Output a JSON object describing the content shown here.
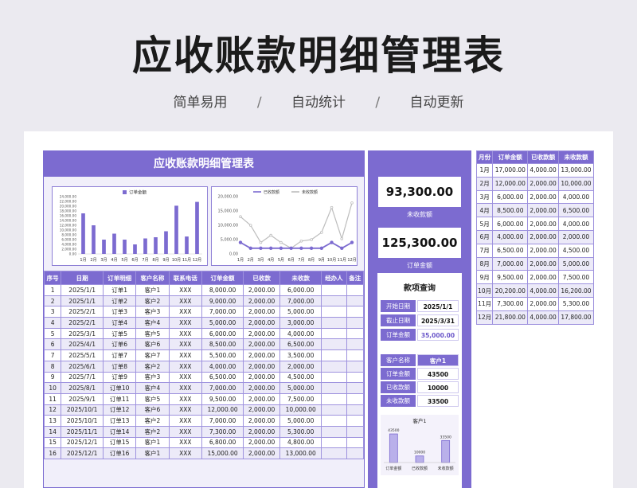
{
  "header": {
    "title": "应收账款明细管理表",
    "tags": [
      "简单易用",
      "自动统计",
      "自动更新"
    ],
    "separator": "/"
  },
  "panel": {
    "title": "应收账款明细管理表"
  },
  "colors": {
    "accent": "#7c6bd0",
    "light": "#eceaf8",
    "line_received": "#7c6bd0",
    "line_outstanding": "#bdbdbd"
  },
  "chart_data": [
    {
      "type": "bar",
      "title": "",
      "legend": [
        "订单金额"
      ],
      "categories": [
        "1月",
        "2月",
        "3月",
        "4月",
        "5月",
        "6月",
        "7月",
        "8月",
        "9月",
        "10月",
        "11月",
        "12月"
      ],
      "series": [
        {
          "name": "订单金额",
          "values": [
            17000,
            12000,
            6000,
            8500,
            6000,
            4000,
            6500,
            7000,
            9500,
            20200,
            7300,
            21800
          ]
        }
      ],
      "ylim": [
        0,
        24000
      ],
      "yticks": [
        "24,000.00",
        "22,000.00",
        "20,000.00",
        "18,000.00",
        "16,000.00",
        "14,000.00",
        "12,000.00",
        "10,000.00",
        "8,000.00",
        "6,000.00",
        "4,000.00",
        "2,000.00",
        "0.00"
      ],
      "legend_position": "top"
    },
    {
      "type": "line",
      "title": "",
      "categories": [
        "1月",
        "2月",
        "3月",
        "4月",
        "5月",
        "6月",
        "7月",
        "8月",
        "9月",
        "10月",
        "11月",
        "12月"
      ],
      "series": [
        {
          "name": "已收款额",
          "values": [
            4000,
            2000,
            2000,
            2000,
            2000,
            2000,
            2000,
            2000,
            2000,
            4000,
            2000,
            4000
          ]
        },
        {
          "name": "未收款额",
          "values": [
            13000,
            10000,
            4000,
            6500,
            4000,
            2000,
            4500,
            5000,
            7500,
            16200,
            5300,
            17800
          ]
        }
      ],
      "ylim": [
        0,
        20000
      ],
      "yticks": [
        "20,000.00",
        "15,000.00",
        "10,000.00",
        "5,000.00",
        "0.00"
      ],
      "legend_position": "top"
    },
    {
      "type": "bar",
      "title": "客户1",
      "categories": [
        "订单金额",
        "已收款额",
        "未收款额"
      ],
      "values": [
        43500,
        10000,
        33500
      ],
      "value_labels": [
        "43500",
        "10000",
        "33500"
      ]
    }
  ],
  "detail_table": {
    "columns": [
      "序号",
      "日期",
      "订单明细",
      "客户名称",
      "联系电话",
      "订单金额",
      "已收款",
      "未收款",
      "经办人",
      "备注"
    ],
    "rows": [
      [
        "1",
        "2025/1/1",
        "订单1",
        "客户1",
        "XXX",
        "8,000.00",
        "2,000.00",
        "6,000.00",
        "",
        ""
      ],
      [
        "2",
        "2025/1/1",
        "订单2",
        "客户2",
        "XXX",
        "9,000.00",
        "2,000.00",
        "7,000.00",
        "",
        ""
      ],
      [
        "3",
        "2025/2/1",
        "订单3",
        "客户3",
        "XXX",
        "7,000.00",
        "2,000.00",
        "5,000.00",
        "",
        ""
      ],
      [
        "4",
        "2025/2/1",
        "订单4",
        "客户4",
        "XXX",
        "5,000.00",
        "2,000.00",
        "3,000.00",
        "",
        ""
      ],
      [
        "5",
        "2025/3/1",
        "订单5",
        "客户5",
        "XXX",
        "6,000.00",
        "2,000.00",
        "4,000.00",
        "",
        ""
      ],
      [
        "6",
        "2025/4/1",
        "订单6",
        "客户6",
        "XXX",
        "8,500.00",
        "2,000.00",
        "6,500.00",
        "",
        ""
      ],
      [
        "7",
        "2025/5/1",
        "订单7",
        "客户7",
        "XXX",
        "5,500.00",
        "2,000.00",
        "3,500.00",
        "",
        ""
      ],
      [
        "8",
        "2025/6/1",
        "订单8",
        "客户2",
        "XXX",
        "4,000.00",
        "2,000.00",
        "2,000.00",
        "",
        ""
      ],
      [
        "9",
        "2025/7/1",
        "订单9",
        "客户3",
        "XXX",
        "6,500.00",
        "2,000.00",
        "4,500.00",
        "",
        ""
      ],
      [
        "10",
        "2025/8/1",
        "订单10",
        "客户4",
        "XXX",
        "7,000.00",
        "2,000.00",
        "5,000.00",
        "",
        ""
      ],
      [
        "11",
        "2025/9/1",
        "订单11",
        "客户5",
        "XXX",
        "9,500.00",
        "2,000.00",
        "7,500.00",
        "",
        ""
      ],
      [
        "12",
        "2025/10/1",
        "订单12",
        "客户6",
        "XXX",
        "12,000.00",
        "2,000.00",
        "10,000.00",
        "",
        ""
      ],
      [
        "13",
        "2025/10/1",
        "订单13",
        "客户2",
        "XXX",
        "7,000.00",
        "2,000.00",
        "5,000.00",
        "",
        ""
      ],
      [
        "14",
        "2025/11/1",
        "订单14",
        "客户2",
        "XXX",
        "7,300.00",
        "2,000.00",
        "5,300.00",
        "",
        ""
      ],
      [
        "15",
        "2025/12/1",
        "订单15",
        "客户1",
        "XXX",
        "6,800.00",
        "2,000.00",
        "4,800.00",
        "",
        ""
      ],
      [
        "16",
        "2025/12/1",
        "订单16",
        "客户1",
        "XXX",
        "15,000.00",
        "2,000.00",
        "13,000.00",
        "",
        ""
      ]
    ]
  },
  "kpis": {
    "outstanding": {
      "value": "93,300.00",
      "label": "未收款额"
    },
    "order_total": {
      "value": "125,300.00",
      "label": "订单金额"
    }
  },
  "query": {
    "title": "款项查询",
    "start_label": "开始日期",
    "start_value": "2025/1/1",
    "end_label": "截止日期",
    "end_value": "2025/3/31",
    "order_label": "订单金额",
    "order_value": "35,000.00",
    "customer_label": "客户名称",
    "customer_value": "客户1",
    "c_order_label": "订单金额",
    "c_order_value": "43500",
    "c_received_label": "已收款额",
    "c_received_value": "10000",
    "c_outstanding_label": "未收款额",
    "c_outstanding_value": "33500"
  },
  "monthly_table": {
    "columns": [
      "月份",
      "订单金额",
      "已收款额",
      "未收款额"
    ],
    "rows": [
      [
        "1月",
        "17,000.00",
        "4,000.00",
        "13,000.00"
      ],
      [
        "2月",
        "12,000.00",
        "2,000.00",
        "10,000.00"
      ],
      [
        "3月",
        "6,000.00",
        "2,000.00",
        "4,000.00"
      ],
      [
        "4月",
        "8,500.00",
        "2,000.00",
        "6,500.00"
      ],
      [
        "5月",
        "6,000.00",
        "2,000.00",
        "4,000.00"
      ],
      [
        "6月",
        "4,000.00",
        "2,000.00",
        "2,000.00"
      ],
      [
        "7月",
        "6,500.00",
        "2,000.00",
        "4,500.00"
      ],
      [
        "8月",
        "7,000.00",
        "2,000.00",
        "5,000.00"
      ],
      [
        "9月",
        "9,500.00",
        "2,000.00",
        "7,500.00"
      ],
      [
        "10月",
        "20,200.00",
        "4,000.00",
        "16,200.00"
      ],
      [
        "11月",
        "7,300.00",
        "2,000.00",
        "5,300.00"
      ],
      [
        "12月",
        "21,800.00",
        "4,000.00",
        "17,800.00"
      ]
    ]
  }
}
